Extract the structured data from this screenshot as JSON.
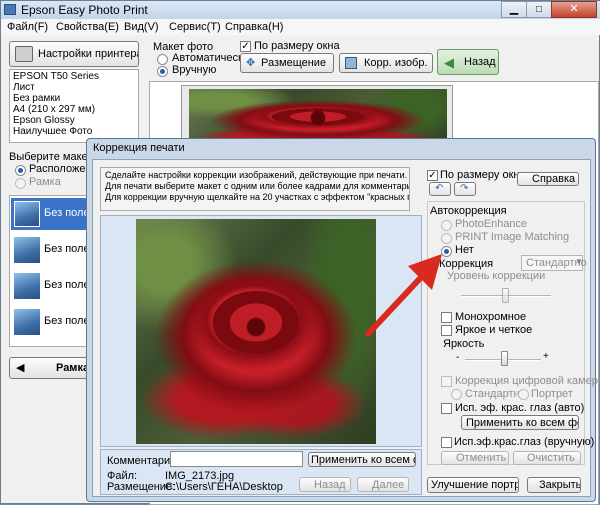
{
  "main_window": {
    "title": "Epson Easy Photo Print",
    "menu": [
      "Файл(F)",
      "Свойства(E)",
      "Вид(V)",
      "Сервис(T)",
      "Справка(H)"
    ],
    "printer_settings_btn": "Настройки принтера",
    "printer_info": [
      "EPSON T50 Series",
      "Лист",
      "Без рамки",
      "A4 (210 x 297 мм)",
      "Epson Glossy",
      "Наилучшее Фото"
    ],
    "layout_label": "Макет фото",
    "layout_auto": "Автоматически",
    "layout_manual": "Вручную",
    "fit_window": "По размеру окна",
    "placement_btn": "Размещение",
    "correct_btn": "Корр. изобр.",
    "back_btn": "Назад",
    "choose_layout": "Выберите макет",
    "arrangement": "Расположение ф",
    "frame": "Рамка",
    "templates": [
      "Без полей",
      "Без полей (",
      "Без полей (",
      "Без полей ("
    ],
    "frame_btn": "Рамка"
  },
  "dialog": {
    "title": "Коррекция печати",
    "instructions": [
      "Сделайте настройки коррекции изображений, действующие при печати.",
      "Для печати выберите макет с одним или более кадрами для комментариев.",
      "Для коррекции вручную щелкайте на 20 участках с эффектом \"красных глаз\"."
    ],
    "fit_window": "По размеру окна",
    "help_btn": "Справка",
    "auto_correction": "Автокоррекция",
    "photo_enhance": "PhotoEnhance",
    "print_image_matching": "PRINT Image Matching",
    "none": "Нет",
    "correction_label": "Коррекция",
    "correction_value": "Стандартно",
    "correction_level": "Уровень коррекции",
    "monochrome": "Монохромное",
    "bright_sharp": "Яркое и четкое",
    "brightness": "Яркость",
    "digital_camera_correction": "Коррекция цифровой камеры",
    "standard": "Стандартно",
    "portrait": "Портрет",
    "red_eye_auto": "Исп. эф. крас. глаз (авто)",
    "apply_all_btn": "Применить ко всем фото",
    "red_eye_manual": "Исп.эф.крас.глаз (вручную)",
    "cancel_btn": "Отменить",
    "clear_btn": "Очистить",
    "comment_label": "Комментарии:",
    "comment_value": "",
    "apply_all_comment_btn": "Применить ко всем фото",
    "file_label": "Файл:",
    "file_value": "IMG_2173.jpg",
    "location_label": "Размещение:",
    "location_value": "C:\\Users\\ГЕНА\\Desktop",
    "back_btn": "Назад",
    "next_btn": "Далее",
    "portrait_improve_btn": "Улучшение портрета",
    "close_btn": "Закрыть"
  }
}
